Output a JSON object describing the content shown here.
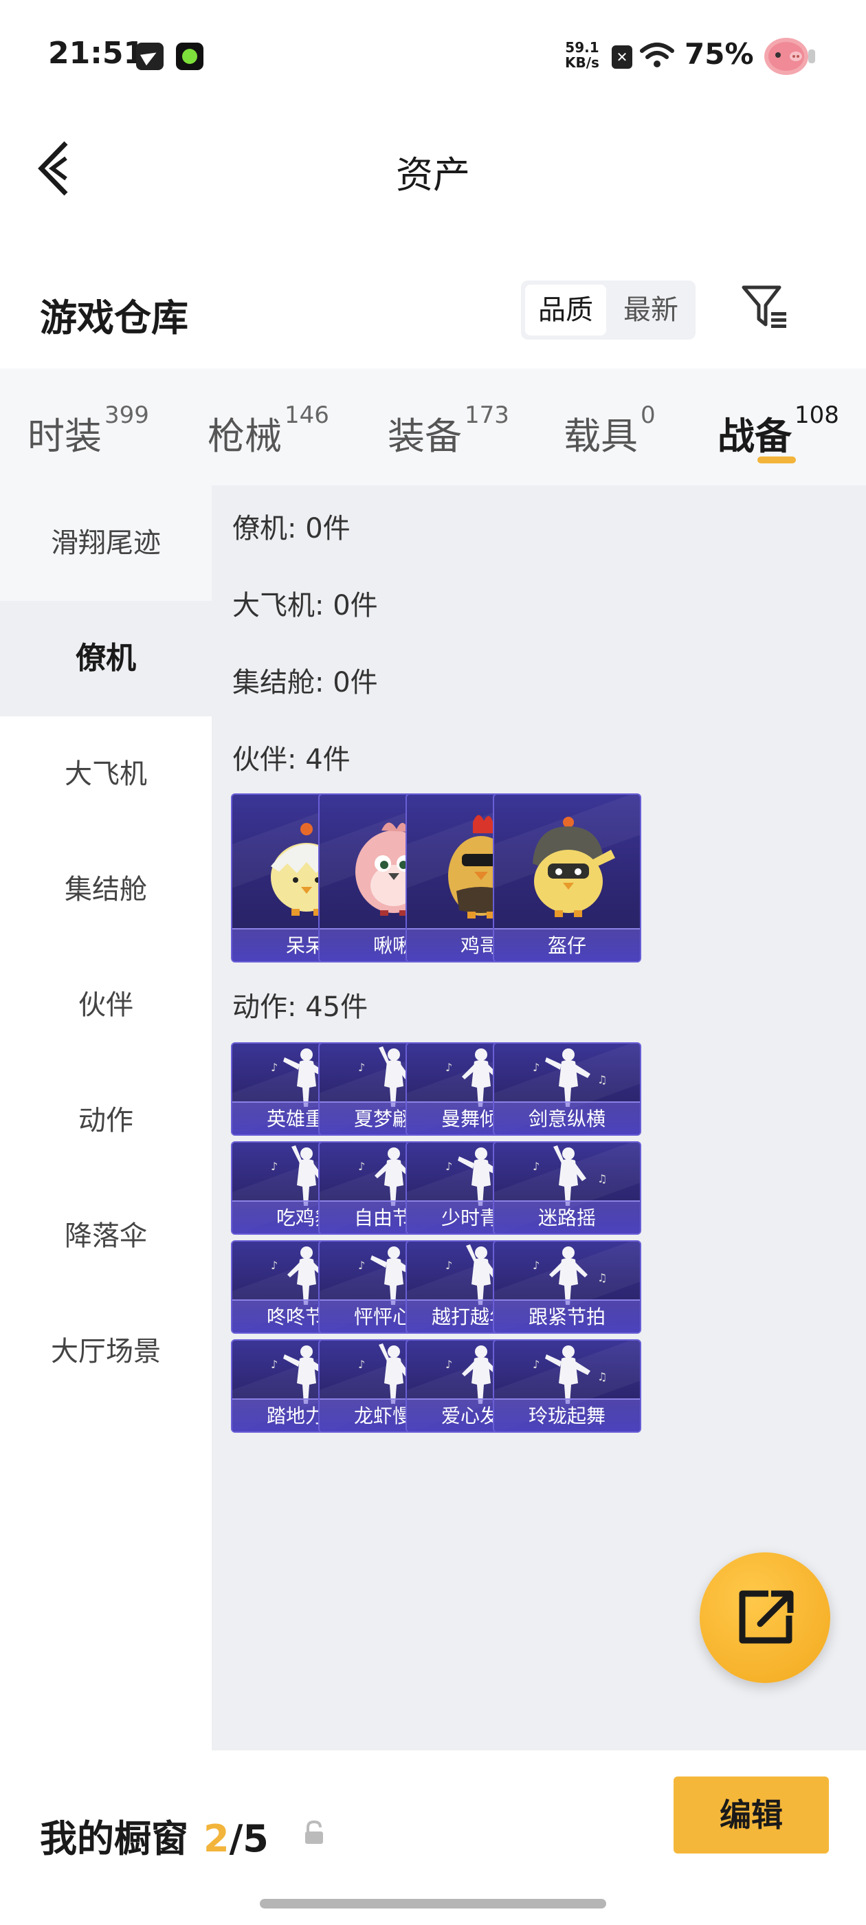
{
  "status_bar": {
    "time": "21:51",
    "speed_value": "59.1",
    "speed_unit": "KB/s",
    "battery": "75%"
  },
  "nav": {
    "title": "资产"
  },
  "header": {
    "title": "游戏仓库",
    "sort_options": [
      "品质",
      "最新"
    ],
    "sort_selected": "品质"
  },
  "tabs": [
    {
      "label": "时装",
      "count": "399"
    },
    {
      "label": "枪械",
      "count": "146"
    },
    {
      "label": "装备",
      "count": "173"
    },
    {
      "label": "载具",
      "count": "0"
    },
    {
      "label": "战备",
      "count": "108"
    }
  ],
  "active_tab": "战备",
  "sidebar": {
    "items": [
      "滑翔尾迹",
      "僚机",
      "大飞机",
      "集结舱",
      "伙伴",
      "动作",
      "降落伞",
      "大厅场景"
    ],
    "selected": "僚机"
  },
  "sections": {
    "wingman": "僚机: 0件",
    "plane": "大飞机: 0件",
    "pod": "集结舱: 0件",
    "partner": "伙伴: 4件",
    "emote": "动作: 45件"
  },
  "partners": [
    "呆呆",
    "啾啾",
    "鸡哥",
    "盔仔"
  ],
  "emotes": [
    "英雄重生",
    "夏梦翩跹",
    "曼舞倾心",
    "剑意纵横",
    "吃鸡舞",
    "自由节拍",
    "少时青春",
    "迷路摇",
    "咚咚节拍",
    "怦怦心跳",
    "越打越年轻",
    "跟紧节拍",
    "踏地力量",
    "龙虾慢摇",
    "爱心发射",
    "玲珑起舞"
  ],
  "bottom": {
    "showcase_label": "我的橱窗",
    "showcase_current": "2",
    "showcase_total": "/5",
    "edit_label": "编辑"
  },
  "colors": {
    "accent": "#f2b43a",
    "card_bg": "#2e2773",
    "card_border": "#6a5fd6"
  }
}
